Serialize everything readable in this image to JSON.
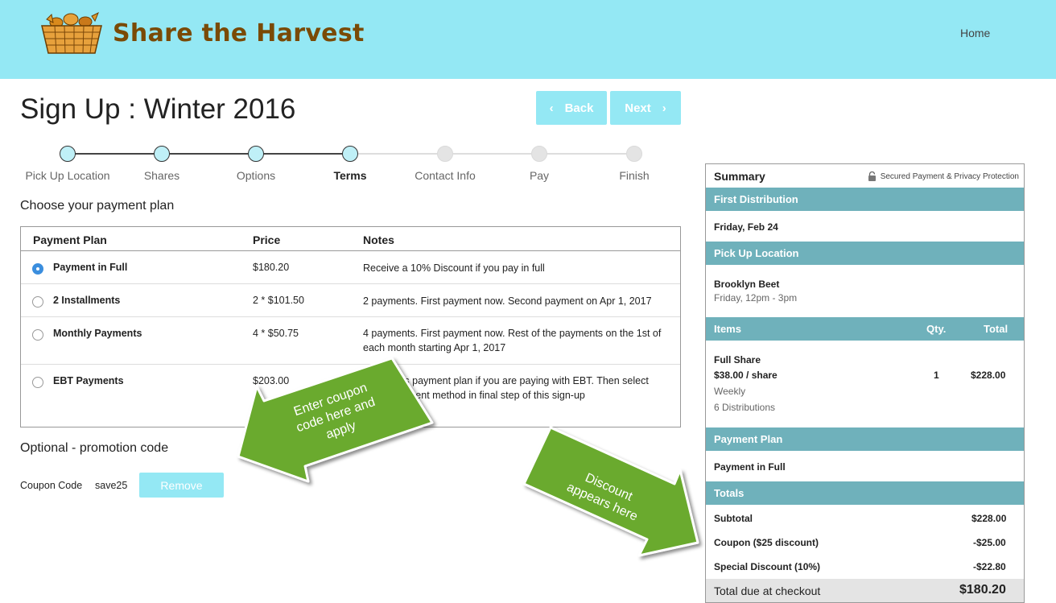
{
  "header": {
    "brand": "Share the Harvest",
    "nav_home": "Home"
  },
  "page": {
    "title": "Sign Up : Winter 2016"
  },
  "wizard": {
    "back_label": "Back",
    "next_label": "Next"
  },
  "steps": [
    {
      "label": "Pick Up Location",
      "state": "done"
    },
    {
      "label": "Shares",
      "state": "done"
    },
    {
      "label": "Options",
      "state": "done"
    },
    {
      "label": "Terms",
      "state": "current"
    },
    {
      "label": "Contact Info",
      "state": "todo"
    },
    {
      "label": "Pay",
      "state": "todo"
    },
    {
      "label": "Finish",
      "state": "todo"
    }
  ],
  "payment": {
    "section_title": "Choose your payment plan",
    "headers": {
      "plan": "Payment Plan",
      "price": "Price",
      "notes": "Notes"
    },
    "rows": [
      {
        "name": "Payment in Full",
        "price": "$180.20",
        "note": "Receive a 10% Discount if you pay in full",
        "selected": true
      },
      {
        "name": "2 Installments",
        "price": "2 * $101.50",
        "note": "2 payments. First payment now. Second payment on Apr 1, 2017",
        "selected": false
      },
      {
        "name": "Monthly Payments",
        "price": "4 * $50.75",
        "note": "4 payments. First payment now. Rest of the payments on the 1st of each month starting Apr 1, 2017",
        "selected": false
      },
      {
        "name": "EBT Payments",
        "price": "$203.00",
        "note": "Select this payment plan if you are paying with EBT. Then select Other payment method in final step of this sign-up",
        "selected": false
      }
    ]
  },
  "promo": {
    "title": "Optional - promotion code",
    "coupon_label": "Coupon Code",
    "coupon_value": "save25",
    "remove_label": "Remove"
  },
  "summary": {
    "title": "Summary",
    "secure_text": "Secured Payment & Privacy Protection",
    "first_distribution": {
      "heading": "First Distribution",
      "date": "Friday, Feb 24"
    },
    "pickup": {
      "heading": "Pick Up Location",
      "name": "Brooklyn Beet",
      "time": "Friday, 12pm - 3pm"
    },
    "items": {
      "heading": "Items",
      "qty_heading": "Qty.",
      "total_heading": "Total",
      "name": "Full Share",
      "price": "$38.00 / share",
      "frequency": "Weekly",
      "distributions": "6 Distributions",
      "qty": "1",
      "total": "$228.00"
    },
    "plan": {
      "heading": "Payment Plan",
      "value": "Payment in Full"
    },
    "totals": {
      "heading": "Totals",
      "subtotal_label": "Subtotal",
      "subtotal": "$228.00",
      "coupon_label": "Coupon ($25 discount)",
      "coupon": "-$25.00",
      "special_label": "Special Discount (10%)",
      "special": "-$22.80",
      "due_label": "Total due at checkout",
      "due": "$180.20"
    }
  },
  "annotations": {
    "coupon_callout": [
      "Enter coupon",
      "code here and",
      "apply"
    ],
    "discount_callout": [
      "Discount",
      "appears here"
    ]
  },
  "colors": {
    "header_bg": "#94e8f4",
    "brand": "#7a4a06",
    "band": "#6fb1bb",
    "arrow": "#6aaa2e",
    "accent": "#3b8ede"
  }
}
